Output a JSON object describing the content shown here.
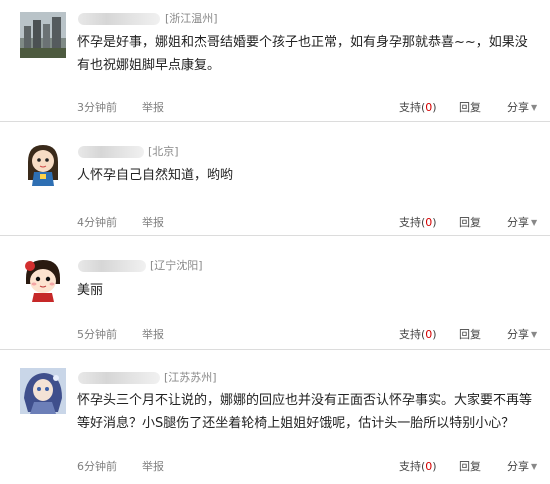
{
  "comments": [
    {
      "location": "[浙江温州]",
      "content": "怀孕是好事，娜姐和杰哥结婚要个孩子也正常，如有身孕那就恭喜~~，如果没有也祝娜姐脚早点康复。",
      "time": "3分钟前",
      "report": "举报",
      "support_label": "支持",
      "support_open": "(",
      "support_count": "0",
      "support_close": ")",
      "reply": "回复",
      "share": "分享",
      "avatar": "city-skyline-avatar"
    },
    {
      "location": "[北京]",
      "content": "人怀孕自己自然知道，哟哟",
      "time": "4分钟前",
      "report": "举报",
      "support_label": "支持",
      "support_open": "(",
      "support_count": "0",
      "support_close": ")",
      "reply": "回复",
      "share": "分享",
      "avatar": "cartoon-girl-avatar"
    },
    {
      "location": "[辽宁沈阳]",
      "content": "美丽",
      "time": "5分钟前",
      "report": "举报",
      "support_label": "支持",
      "support_open": "(",
      "support_count": "0",
      "support_close": ")",
      "reply": "回复",
      "share": "分享",
      "avatar": "cartoon-face-avatar"
    },
    {
      "location": "[江苏苏州]",
      "content": "怀孕头三个月不让说的，娜娜的回应也并没有正面否认怀孕事实。大家要不再等等好消息？小S腿伤了还坐着轮椅上姐姐好饿呢，估计头一胎所以特别小心？",
      "time": "6分钟前",
      "report": "举报",
      "support_label": "支持",
      "support_open": "(",
      "support_count": "0",
      "support_close": ")",
      "reply": "回复",
      "share": "分享",
      "avatar": "anime-character-avatar"
    }
  ],
  "colors": {
    "support_count": "#d40000",
    "divider": "#dcdcdc",
    "meta_text": "#7f7f7f"
  }
}
